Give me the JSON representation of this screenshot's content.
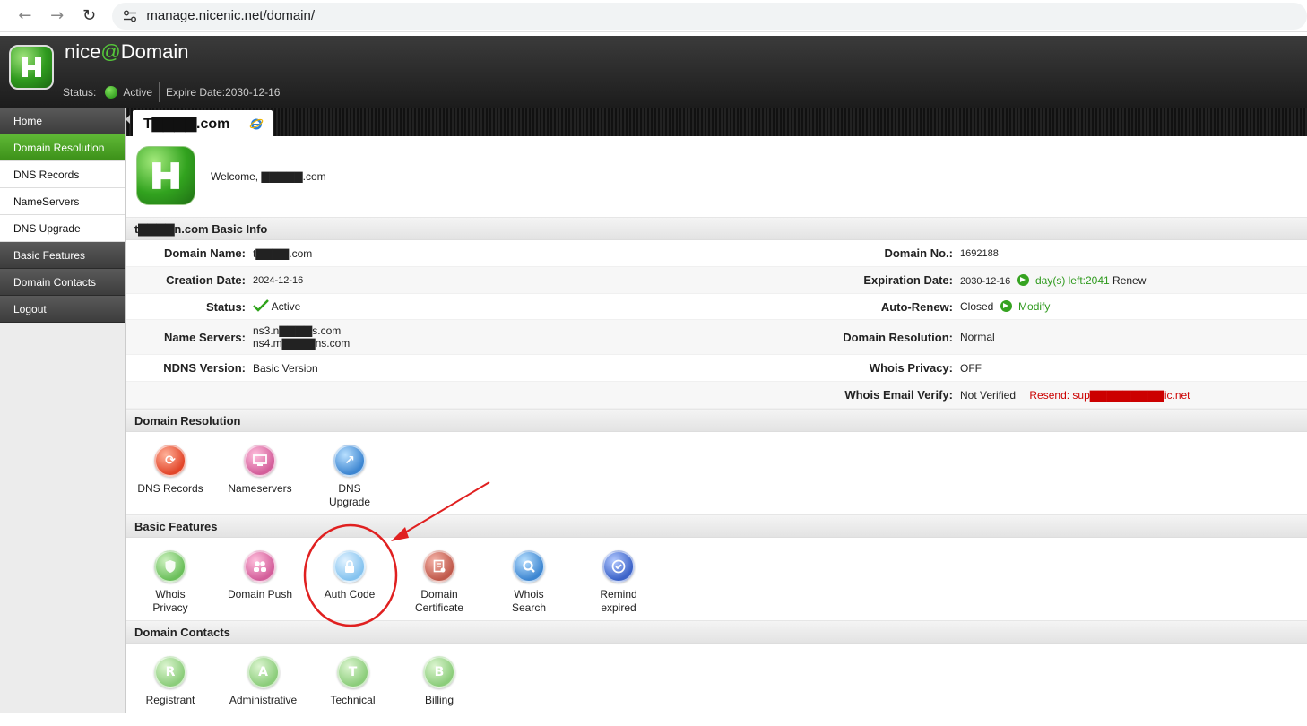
{
  "browser": {
    "back_icon": "arrow-left-icon",
    "forward_icon": "arrow-right-icon",
    "reload_icon": "reload-icon",
    "url": "manage.nicenic.net/domain/"
  },
  "header": {
    "brand_prefix": "nice",
    "brand_at": "@",
    "brand_suffix": "Domain",
    "status_label": "Status:",
    "status_value": "Active",
    "expire_label": "Expire Date:2030-12-16"
  },
  "sidebar": {
    "items": [
      {
        "label": "Home",
        "style": "dark"
      },
      {
        "label": "Domain Resolution",
        "style": "active"
      },
      {
        "label": "DNS Records",
        "style": "sub"
      },
      {
        "label": "NameServers",
        "style": "sub"
      },
      {
        "label": "DNS Upgrade",
        "style": "sub"
      },
      {
        "label": "Basic Features",
        "style": "dark"
      },
      {
        "label": "Domain Contacts",
        "style": "dark"
      },
      {
        "label": "Logout",
        "style": "dark"
      }
    ]
  },
  "tab": {
    "title": "T▇▇▇▇.com"
  },
  "welcome": {
    "text": "Welcome, ▇▇▇▇▇.com"
  },
  "basic_info": {
    "heading": "t▇▇▇▇n.com Basic Info",
    "domain_name_label": "Domain Name:",
    "domain_name_value": "t▇▇▇▇.com",
    "domain_no_label": "Domain No.:",
    "domain_no_value": "1692188",
    "creation_label": "Creation Date:",
    "creation_value": "2024-12-16",
    "expiration_label": "Expiration Date:",
    "expiration_value": "2030-12-16",
    "days_left": "day(s) left:2041",
    "renew_label": "Renew",
    "status_label": "Status:",
    "status_value": "Active",
    "autorenew_label": "Auto-Renew:",
    "autorenew_value": "Closed",
    "modify_label": "Modify",
    "ns_label": "Name Servers:",
    "ns1": "ns3.n▇▇▇▇s.com",
    "ns2": "ns4.m▇▇▇▇ns.com",
    "resolution_label": "Domain Resolution:",
    "resolution_value": "Normal",
    "ndns_label": "NDNS Version:",
    "ndns_value": "Basic Version",
    "whois_privacy_label": "Whois Privacy:",
    "whois_privacy_value": "OFF",
    "whois_email_label": "Whois Email Verify:",
    "whois_email_value": "Not Verified",
    "resend_label": "Resend: sup▇▇▇▇▇▇▇▇▇ic.net"
  },
  "domain_resolution": {
    "heading": "Domain Resolution",
    "items": [
      {
        "label": "DNS Records",
        "icon": "refresh-icon"
      },
      {
        "label": "Nameservers",
        "icon": "monitor-icon"
      },
      {
        "label": "DNS Upgrade",
        "icon": "upgrade-arrow-icon"
      }
    ]
  },
  "basic_features": {
    "heading": "Basic Features",
    "items": [
      {
        "label": "Whois Privacy",
        "icon": "shield-icon"
      },
      {
        "label": "Domain Push",
        "icon": "users-icon"
      },
      {
        "label": "Auth Code",
        "icon": "lock-icon"
      },
      {
        "label": "Domain Certificate",
        "icon": "certificate-icon"
      },
      {
        "label": "Whois Search",
        "icon": "magnifier-icon"
      },
      {
        "label": "Remind expired",
        "icon": "clock-check-icon"
      }
    ]
  },
  "domain_contacts": {
    "heading": "Domain Contacts",
    "items": [
      {
        "label": "Registrant",
        "icon": "person-r-icon",
        "letter": "R"
      },
      {
        "label": "Administrative",
        "icon": "person-a-icon",
        "letter": "A"
      },
      {
        "label": "Technical",
        "icon": "person-t-icon",
        "letter": "T"
      },
      {
        "label": "Billing",
        "icon": "person-b-icon",
        "letter": "B"
      }
    ]
  },
  "colors": {
    "accent_green": "#3c9019",
    "annotation_red": "#e02020",
    "link_red": "#cc0000"
  }
}
